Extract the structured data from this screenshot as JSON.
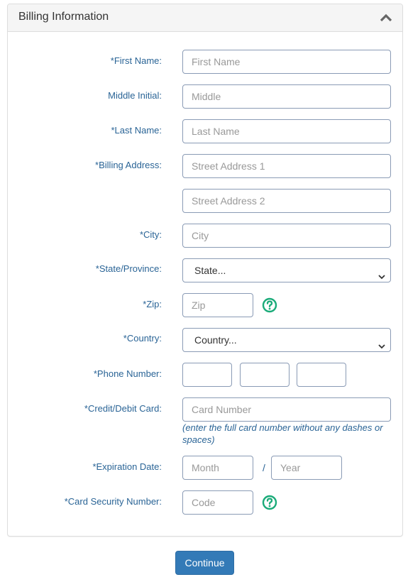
{
  "panel": {
    "title": "Billing Information",
    "collapse_icon": "chevron-up-icon"
  },
  "form": {
    "first_name": {
      "label": "*First Name:",
      "placeholder": "First Name",
      "value": ""
    },
    "middle_initial": {
      "label": "Middle Initial:",
      "placeholder": "Middle",
      "value": ""
    },
    "last_name": {
      "label": "*Last Name:",
      "placeholder": "Last Name",
      "value": ""
    },
    "billing_address": {
      "label": "*Billing Address:",
      "placeholder_1": "Street Address 1",
      "placeholder_2": "Street Address 2"
    },
    "city": {
      "label": "*City:",
      "placeholder": "City"
    },
    "state": {
      "label": "*State/Province:",
      "selected": "State..."
    },
    "zip": {
      "label": "*Zip:",
      "placeholder": "Zip",
      "help_icon": "question-circle-icon"
    },
    "country": {
      "label": "*Country:",
      "selected": "Country..."
    },
    "phone": {
      "label": "*Phone Number:",
      "part1": "",
      "part2": "",
      "part3": ""
    },
    "card": {
      "label": "*Credit/Debit Card:",
      "placeholder": "Card Number",
      "hint": "(enter the full card number without any dashes or spaces)"
    },
    "expiration": {
      "label": "*Expiration Date:",
      "month_placeholder": "Month",
      "separator": "/",
      "year_placeholder": "Year"
    },
    "security": {
      "label": "*Card Security Number:",
      "placeholder": "Code",
      "help_icon": "question-circle-icon"
    }
  },
  "actions": {
    "continue_label": "Continue"
  },
  "colors": {
    "label": "#2a6496",
    "primary": "#337ab7",
    "help": "#1aab79"
  }
}
